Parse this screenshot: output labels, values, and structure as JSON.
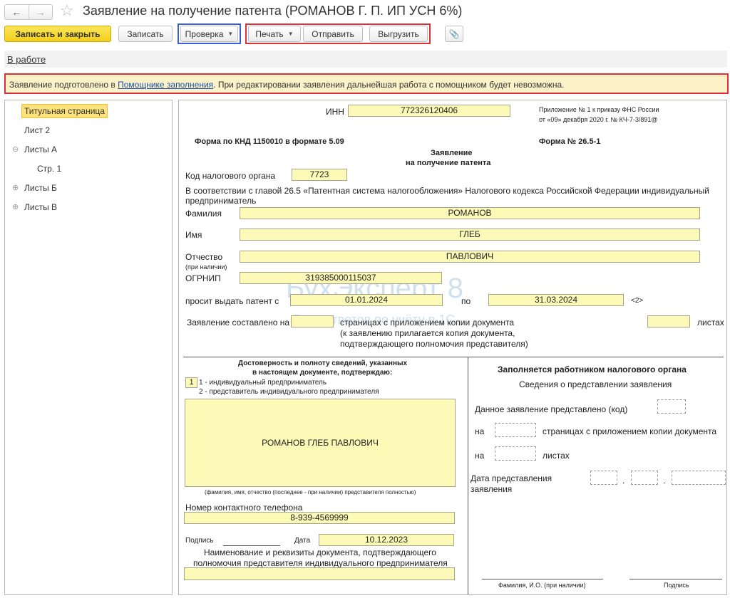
{
  "window": {
    "title": "Заявление на получение патента (РОМАНОВ Г. П. ИП УСН 6%)",
    "nav_back_icon": "←",
    "nav_forward_icon": "→",
    "favorite_icon": "☆"
  },
  "toolbar": {
    "save_close": "Записать и закрыть",
    "save": "Записать",
    "check": "Проверка",
    "print": "Печать",
    "send": "Отправить",
    "export": "Выгрузить",
    "attach_icon": "📎"
  },
  "status": {
    "label": "В работе"
  },
  "notice": {
    "before": "Заявление подготовлено в ",
    "link": "Помощнике заполнения",
    "after": ". При редактировании заявления дальнейшая работа с помощником будет невозможна."
  },
  "tree": {
    "items": [
      {
        "label": "Титульная страница"
      },
      {
        "label": "Лист 2"
      },
      {
        "label": "Листы А",
        "expander": "⊖"
      },
      {
        "label": "Стр. 1"
      },
      {
        "label": "Листы Б",
        "expander": "⊕"
      },
      {
        "label": "Листы В",
        "expander": "⊕"
      }
    ]
  },
  "form": {
    "inn_label": "ИНН",
    "inn": "772326120406",
    "appendix_line1": "Приложение № 1 к приказу ФНС России",
    "appendix_line2": "от «09» декабря 2020 г. № КЧ-7-3/891@",
    "knd": "Форма по КНД 1150010 в формате 5.09",
    "form_no": "Форма № 26.5-1",
    "heading1": "Заявление",
    "heading2": "на получение патента",
    "tax_code_label": "Код налогового органа",
    "tax_code": "7723",
    "intro_line1": "В соответствии с главой 26.5 «Патентная система налогообложения» Налогового кодекса Российской Федерации индивидуальный",
    "intro_line2": "предприниматель",
    "surname_label": "Фамилия",
    "surname": "РОМАНОВ",
    "name_label": "Имя",
    "name": "ГЛЕБ",
    "patronymic_label": "Отчество",
    "patronymic_note": "(при наличии)",
    "patronymic": "ПАВЛОВИЧ",
    "ogrnip_label": "ОГРНИП",
    "ogrnip": "319385000115037",
    "period_label": "просит выдать патент с",
    "date_from": "01.01.2024",
    "to_label": "по",
    "date_to": "31.03.2024",
    "footnote": "<2>",
    "pages_label": "Заявление составлено на",
    "pages_text1": "страницах с приложением копии документа",
    "pages_text2": "(к заявлению прилагается копия документа,",
    "pages_text3": "подтверждающего полномочия представителя)",
    "sheets_label": "листах",
    "confirm_line1": "Достоверность и полноту сведений, указанных",
    "confirm_line2": "в настоящем документе, подтверждаю:",
    "signer_code": "1",
    "signer_opt1": "1 - индивидуальный предприниматель",
    "signer_opt2": "2 - представитель индивидуального предпринимателя",
    "signer_name": "РОМАНОВ ГЛЕБ ПАВЛОВИЧ",
    "signer_note": "(фамилия, имя, отчество (последнее - при наличии) представителя полностью)",
    "phone_label": "Номер контактного телефона",
    "phone": "8-939-4569999",
    "signature_label": "Подпись",
    "date_label": "Дата",
    "sign_date": "10.12.2023",
    "doc_label1": "Наименование и реквизиты документа, подтверждающего",
    "doc_label2": "полномочия представителя индивидуального предпринимателя",
    "tax_heading": "Заполняется работником налогового органа",
    "tax_sub": "Сведения о представлении заявления",
    "tax_submitted": "Данное заявление представлено (код)",
    "tax_on": "на",
    "tax_pages": "страницах с приложением копии документа",
    "tax_on2": "на",
    "tax_sheets": "листах",
    "tax_date1": "Дата представления",
    "tax_date2": "заявления",
    "tax_fio": "Фамилия, И.О. (при наличии)",
    "tax_sign": "Подпись"
  },
  "watermark": {
    "brand": "БухЭксперт 8",
    "tagline": "База ответов по учёту в 1С"
  }
}
